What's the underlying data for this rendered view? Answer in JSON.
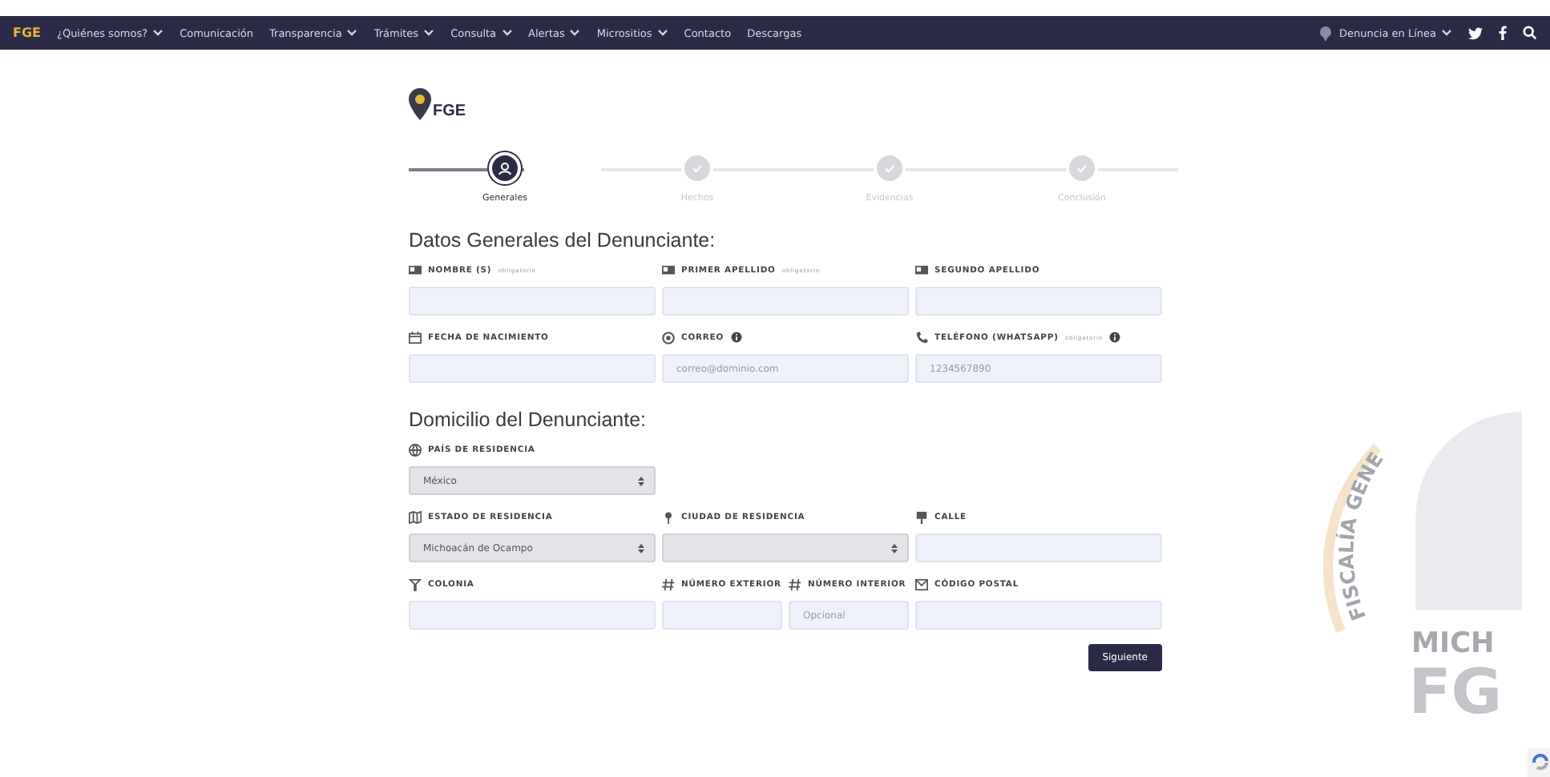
{
  "nav": {
    "brand": "FGE",
    "items": [
      {
        "label": "¿Quiénes somos?",
        "dropdown": true
      },
      {
        "label": "Comunicación",
        "dropdown": false
      },
      {
        "label": "Transparencia",
        "dropdown": true
      },
      {
        "label": "Trámites",
        "dropdown": true
      },
      {
        "label": "Consulta",
        "dropdown": true
      },
      {
        "label": "Alertas",
        "dropdown": true
      },
      {
        "label": "Micrositios",
        "dropdown": true
      },
      {
        "label": "Contacto",
        "dropdown": false
      },
      {
        "label": "Descargas",
        "dropdown": false
      }
    ],
    "online": {
      "label": "Denuncia en Línea",
      "dropdown": true
    }
  },
  "logo": {
    "text": "FGE"
  },
  "steps": [
    {
      "label": "Generales",
      "selected": true
    },
    {
      "label": "Hechos",
      "selected": false
    },
    {
      "label": "Evidencias",
      "selected": false
    },
    {
      "label": "Conclusión",
      "selected": false
    }
  ],
  "sections": [
    {
      "title": "Datos Generales del Denunciante:",
      "rows": [
        [
          {
            "kind": "name",
            "label": "NOMBRE (S)",
            "required": "obligatorio"
          },
          {
            "kind": "name",
            "label": "PRIMER APELLIDO",
            "required": "obligatorio"
          },
          {
            "kind": "name",
            "label": "SEGUNDO APELLIDO"
          }
        ],
        [
          {
            "kind": "date",
            "label": "FECHA DE NACIMIENTO"
          },
          {
            "kind": "email",
            "label": "CORREO",
            "info": true,
            "placeholder": "correo@dominio.com"
          },
          {
            "kind": "phone",
            "label": "TELÉFONO (WHATSAPP)",
            "required": "obligatorio",
            "info": true,
            "placeholder": "1234567890"
          }
        ]
      ]
    },
    {
      "title": "Domicilio del Denunciante:",
      "rows": [
        [
          {
            "kind": "country",
            "label": "PAÍS DE RESIDENCIA",
            "value": "México"
          }
        ],
        [
          {
            "kind": "state",
            "label": "ESTADO DE RESIDENCIA",
            "value": "Michoacán de Ocampo"
          },
          {
            "kind": "city",
            "label": "CIUDAD DE RESIDENCIA"
          },
          {
            "kind": "street",
            "label": "CALLE"
          }
        ],
        [
          {
            "kind": "neighborhood",
            "label": "COLONIA"
          },
          {
            "kind": "pair",
            "parts": [
              {
                "kind": "number",
                "label": "NÚMERO EXTERIOR"
              },
              {
                "kind": "number",
                "label": "NÚMERO INTERIOR",
                "placeholder": "Opcional"
              }
            ]
          },
          {
            "kind": "postal",
            "label": "CÓDIGO POSTAL"
          }
        ]
      ]
    }
  ],
  "next_button": "Siguiente",
  "seal": {
    "arc_text": "FISCALÍA GENE",
    "lower_text": "MICH",
    "big_text": "FG"
  }
}
